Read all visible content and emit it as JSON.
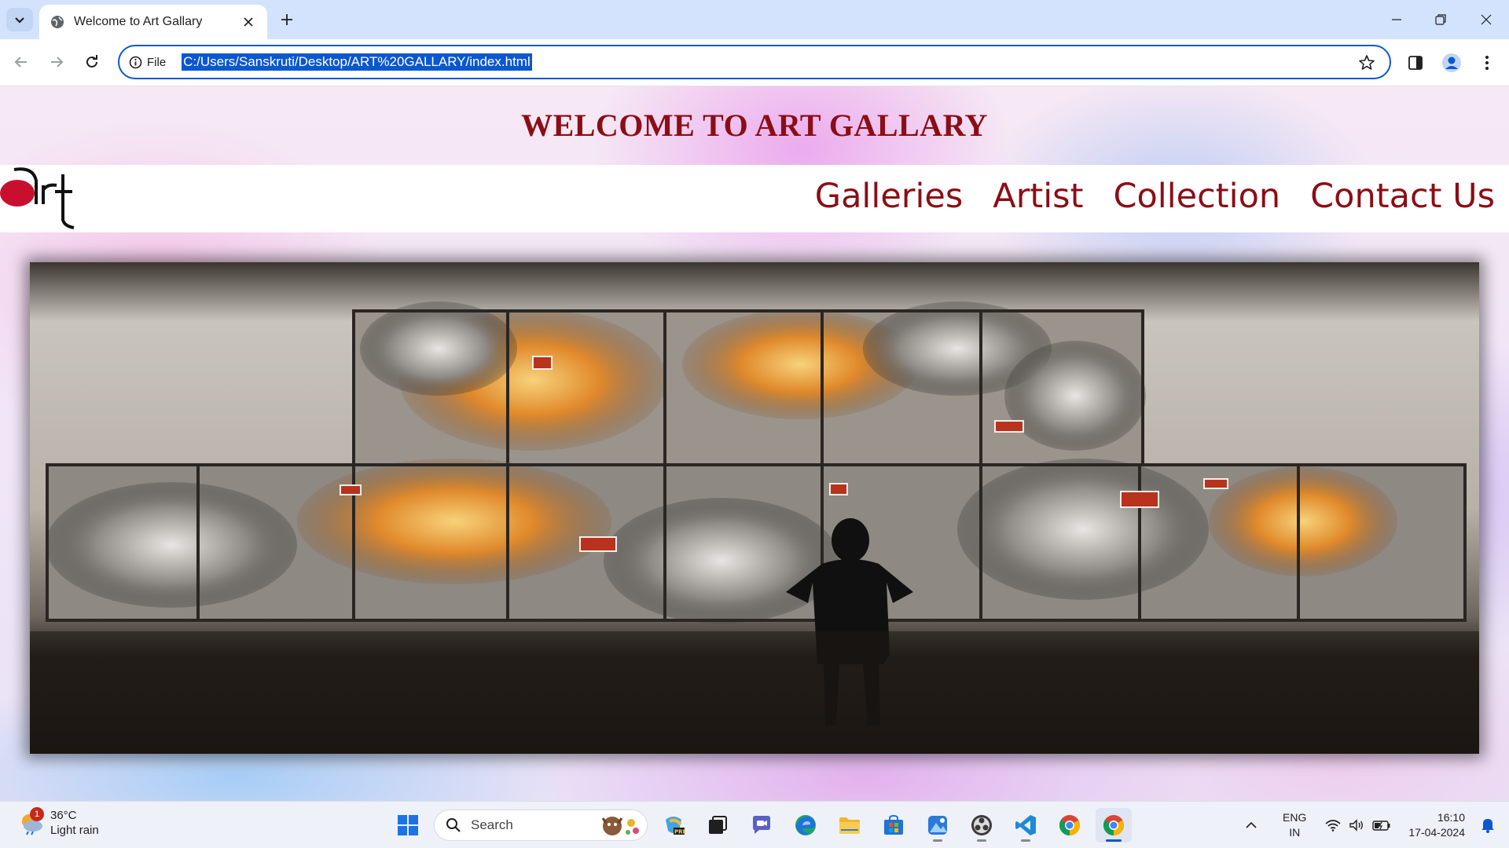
{
  "browser": {
    "tab_title": "Welcome to Art Gallary",
    "site_info_label": "File",
    "url": "C:/Users/Sanskruti/Desktop/ART%20GALLARY/index.html"
  },
  "page": {
    "heading": "WELCOME TO ART GALLARY",
    "logo_text": "art",
    "nav": [
      "Galleries",
      "Artist",
      "Collection",
      "Contact Us"
    ],
    "accent_color": "#8b0d16",
    "hero_image": "gallery wall with large artwork panels and a silhouetted visitor"
  },
  "taskbar": {
    "weather_temp": "36°C",
    "weather_desc": "Light rain",
    "weather_badge": "1",
    "search_placeholder": "Search",
    "lang_line1": "ENG",
    "lang_line2": "IN",
    "time": "16:10",
    "date": "17-04-2024"
  }
}
